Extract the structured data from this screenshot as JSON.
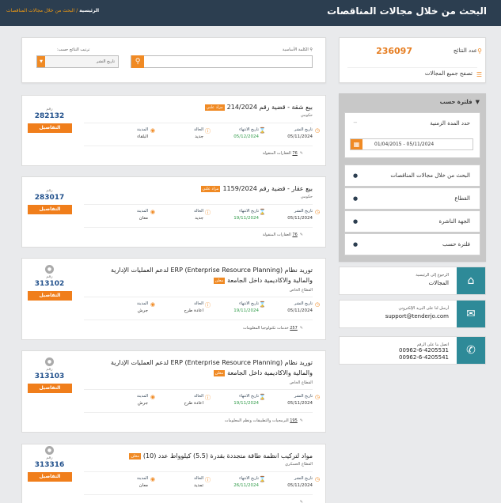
{
  "header": {
    "title": "البحث من خلال مجالات المناقصات",
    "crumb_home": "الرئيسية",
    "crumb_sep": "/",
    "crumb_current": "البحث من خلال مجالات المناقصات"
  },
  "sidebar": {
    "results_count_label": "عدد النتائج",
    "results_count_value": "236097",
    "browse_all_label": "تصفح جميع المجالات",
    "filter_title": "فلترة حسب",
    "date_range_label": "حدد المدة الزمنية",
    "date_range_value": "01/04/2015 - 05/11/2024",
    "filters": [
      "البحث من خلال مجالات المناقصات",
      "القطاع",
      "الجهة الناشرة",
      "فلترة حسب"
    ],
    "contacts": [
      {
        "small": "الرجوع إلى الرئيسية",
        "big": "المجالات",
        "icon": "home-icon"
      },
      {
        "small": "أرسل لنا على البريد الإلكتروني",
        "big": "support@tenderjo.com",
        "icon": "envelope-icon"
      },
      {
        "small": "اتصل بنا على الرقم",
        "big": "00962-6-4205531\n00962-6-4205541",
        "icon": "phone-icon"
      }
    ]
  },
  "search": {
    "keyword_label": "الكلمة الأساسية",
    "sort_label": "ترتيب النتائج حسب:",
    "sort_value": "تاريخ النشر"
  },
  "labels": {
    "tender_no": "رقم",
    "details_button": "التفاصيل",
    "publish_date": "تاريخ النشر",
    "end_date": "تاريخ الانتهاء",
    "status": "الحالة",
    "city": "المدينة"
  },
  "tenders": [
    {
      "title": "بيع شقة - قضية رقم 214/2024",
      "badge": "مزاد علني",
      "sector": "حكومي",
      "number": "282132",
      "publish": "05/11/2024",
      "end": "05/12/2024",
      "status": "جديد",
      "city": "البلقاء",
      "category_count": "76",
      "category": "العقارات المنقولة"
    },
    {
      "title": "بيع عقار - قضية رقم 1159/2024",
      "badge": "مزاد علني",
      "sector": "حكومي",
      "number": "283017",
      "publish": "05/11/2024",
      "end": "19/11/2024",
      "status": "جديد",
      "city": "معان",
      "category_count": "76",
      "category": "العقارات المنقولة"
    },
    {
      "title": "توريد نظام ERP (Enterprise Resource Planning) لدعم العمليات الإدارية والمالية والاكاديمية داخل الجامعة",
      "badge": "معلن",
      "sector": "القطاع الخاص",
      "number": "313102",
      "publish": "05/11/2024",
      "end": "19/11/2024",
      "status": "اعادة طرح",
      "city": "جرش",
      "category_count": "257",
      "category": "خدمات تكنولوجيا المعلومات"
    },
    {
      "title": "توريد نظام ERP (Enterprise Resource Planning) لدعم العمليات الإدارية والمالية والاكاديمية داخل الجامعة",
      "badge": "معلن",
      "sector": "القطاع الخاص",
      "number": "313103",
      "publish": "05/11/2024",
      "end": "19/11/2024",
      "status": "اعادة طرح",
      "city": "جرش",
      "category_count": "195",
      "category": "البرمجيات والتطبيقات ونظم المعلومات"
    },
    {
      "title": "مواد لتركيب انظمة طاقة متجددة بقدرة (5.5) كيلوواط عدد (10)",
      "badge": "معلن",
      "sector": "القطاع العسكري",
      "number": "313316",
      "publish": "05/11/2024",
      "end": "26/11/2024",
      "status": "تمديد",
      "city": "معان",
      "category_count": "",
      "category": ""
    }
  ]
}
